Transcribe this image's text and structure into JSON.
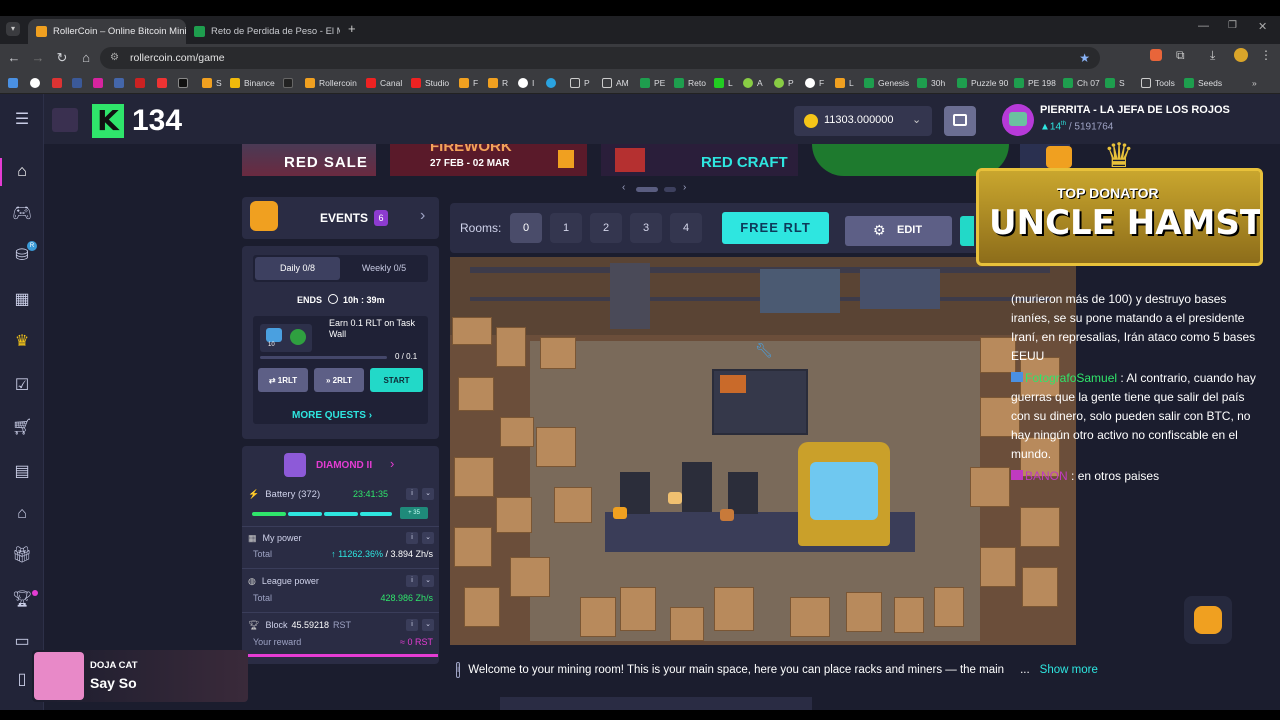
{
  "browser": {
    "tabs": [
      {
        "title": "RollerCoin – Online Bitcoin Mini",
        "active": true
      },
      {
        "title": "Reto de Perdida de Peso - El M",
        "active": false
      }
    ],
    "url": "rollercoin.com/game",
    "bookmarks": [
      "",
      "",
      "",
      "",
      "",
      "",
      "",
      "S",
      "Binance",
      "",
      "Rollercoin",
      "Canal",
      "Studio",
      "F",
      "R",
      "I",
      "",
      "P",
      "AM",
      "PE",
      "Reto",
      "L",
      "A",
      "P",
      "F",
      "L",
      "Genesis",
      "30h",
      "Puzzle 90",
      "PE 198",
      "Ch 07",
      "S",
      "Tools",
      "Seeds"
    ]
  },
  "header": {
    "level_number": "134",
    "balance": "11303.000000",
    "user_name": "PIERRITA - LA JEFA DE LOS ROJOS",
    "rank": "14",
    "rank_suffix": "th",
    "rank_total": "/ 5191764"
  },
  "banners": [
    "RED SALE",
    "FIREWORK",
    "27 FEB - 02 MAR",
    "RED CRAFT"
  ],
  "events": {
    "title": "EVENTS",
    "count": "6",
    "tab_daily": "Daily 0/8",
    "tab_weekly": "Weekly 0/5",
    "ends_label": "ENDS",
    "ends_time": "10h : 39m",
    "task": "Earn 0.1 RLT on Task Wall",
    "task_progress": "0 / 0.1",
    "task_reward": "10",
    "btn1": "⇄ 1RLT",
    "btn2": "» 2RLT",
    "btn_start": "START",
    "more_quests": "MORE QUESTS"
  },
  "league": {
    "name": "DIAMOND II",
    "battery_label": "Battery (372)",
    "battery_time": "23:41:35",
    "battery_badge": "+ 35",
    "my_power_label": "My power",
    "total_label": "Total",
    "my_power_pct": "↑ 11262.36%",
    "my_power_value": "3.894 Zh/s",
    "league_power_label": "League power",
    "league_power_value": "428.986 Zh/s",
    "block_label": "Block",
    "block_value": "45.59218",
    "block_currency": "RST",
    "reward_label": "Your reward",
    "reward_value": "≈ 0 RST"
  },
  "rooms": {
    "label": "Rooms:",
    "numbers": [
      "0",
      "1",
      "2",
      "3",
      "4"
    ],
    "free_rlt": "FREE RLT",
    "edit": "EDIT"
  },
  "donator": {
    "title": "TOP DONATOR",
    "name": "UNCLE HAMSTER"
  },
  "chat": {
    "line1": "(murieron más de 100) y destruyo bases iraníes, se su pone matando a el presidente Iraní, en represalias, Irán ataco como 5 bases EEUU",
    "user2": "FotografoSamuel",
    "line2": " : Al contrario, cuando hay guerras que la gente tiene que salir del país con su dinero, solo pueden salir con BTC, no hay ningún otro activo no confiscable en el mundo.",
    "user3": "BANON",
    "line3": " : en otros paises"
  },
  "info_bar": {
    "text": "Welcome to your mining room! This is your main space, here you can place racks and miners — the main",
    "ellipsis": "...",
    "show_more": "Show more"
  },
  "music": {
    "artist": "DOJA CAT",
    "song": "Say So"
  },
  "colors": {
    "accent_pink": "#e43cd3",
    "accent_cyan": "#2ee6e0",
    "green": "#2fe56b",
    "panel": "#2a2c44"
  }
}
